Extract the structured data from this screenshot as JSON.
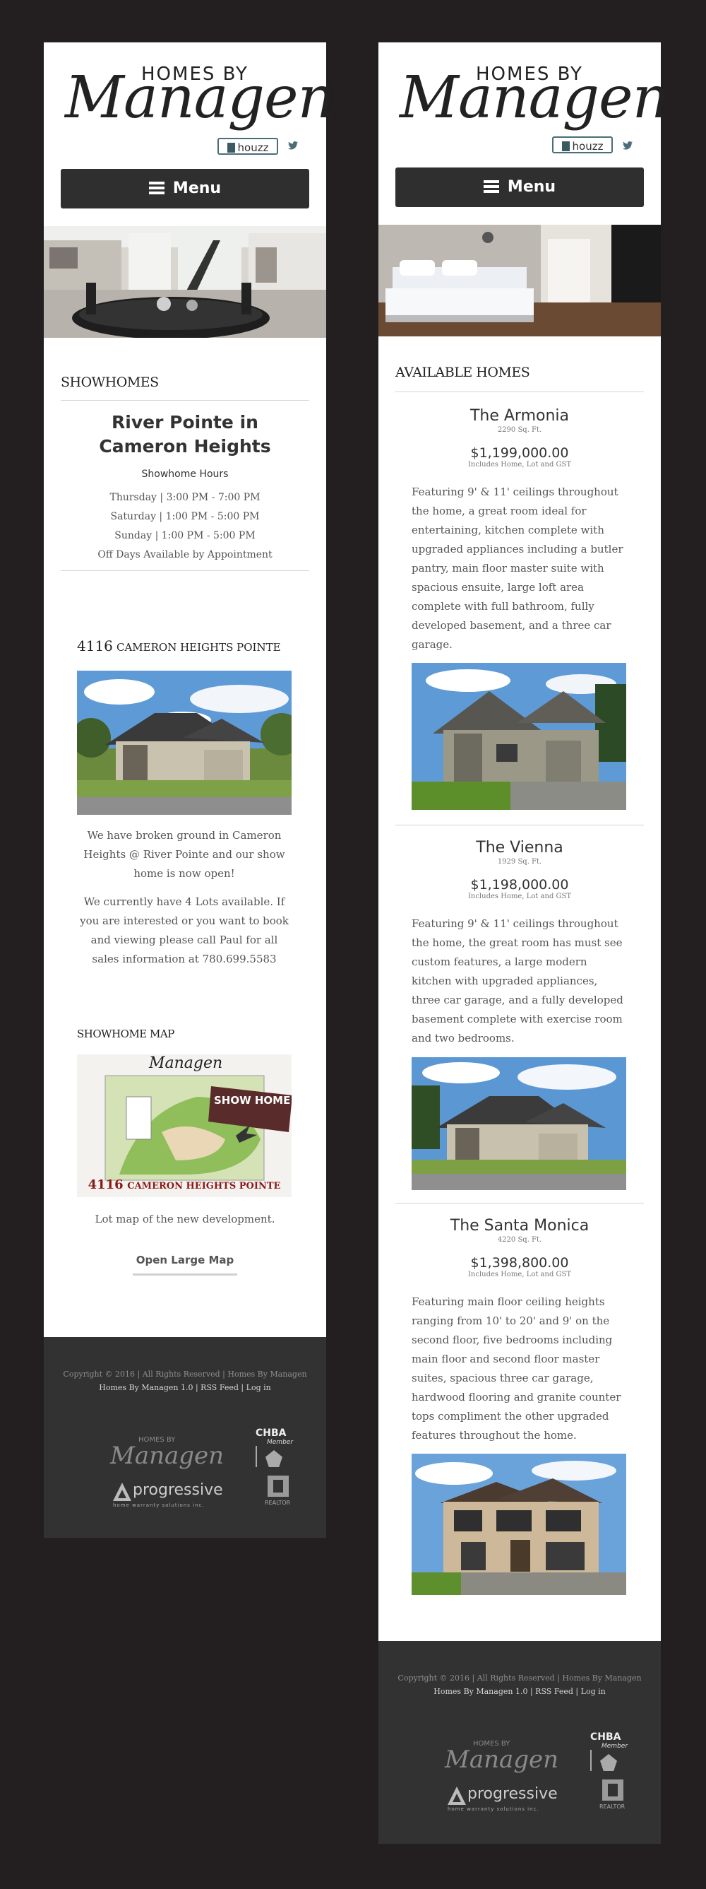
{
  "header": {
    "logo_top": "HOMES BY",
    "logo_script": "Managen",
    "houzz": "houzz",
    "twitter": "🐦",
    "menu": "Menu"
  },
  "left": {
    "showhomes_title": "SHOWHOMES",
    "location_title": "River Pointe in Cameron Heights",
    "hours_label": "Showhome Hours",
    "hours": [
      "Thursday | 3:00 PM - 7:00 PM",
      "Saturday | 1:00 PM - 5:00 PM",
      "Sunday | 1:00 PM - 5:00 PM",
      "Off Days Available by Appointment"
    ],
    "address_number": "4116",
    "address_street": "CAMERON HEIGHTS POINTE",
    "para1": "We have broken ground in Cameron Heights @ River Pointe and our show home is now open!",
    "para2": "We currently have 4 Lots available. If you are interested or you want to book and viewing please call Paul for all sales information at 780.699.5583",
    "map_title": "SHOWHOME MAP",
    "map_logo": "Managen",
    "map_banner": "SHOW HOME OPEN",
    "map_caption_number": "4116",
    "map_caption_street": "CAMERON HEIGHTS POINTE",
    "map_text": "Lot map of the new development.",
    "map_button": "Open Large Map"
  },
  "right": {
    "available_title": "AVAILABLE HOMES",
    "homes": [
      {
        "name": "The Armonia",
        "size": "2290 Sq. Ft.",
        "price": "$1,199,000.00",
        "price_note": "Includes Home, Lot and GST",
        "desc": "Featuring 9' & 11' ceilings throughout the home, a great room ideal for entertaining, kitchen complete with upgraded appliances including a butler pantry, main floor master suite with spacious ensuite, large loft area complete with full bathroom, fully developed basement, and a three car garage."
      },
      {
        "name": "The Vienna",
        "size": "1929 Sq. Ft.",
        "price": "$1,198,000.00",
        "price_note": "Includes Home, Lot and GST",
        "desc": "Featuring 9' & 11' ceilings throughout the home, the great room has must see custom features, a large modern kitchen with upgraded appliances, three car garage, and a fully developed basement complete with exercise room and two bedrooms."
      },
      {
        "name": "The Santa Monica",
        "size": "4220 Sq. Ft.",
        "price": "$1,398,800.00",
        "price_note": "Includes Home, Lot and GST",
        "desc": "Featuring main floor ceiling heights ranging from 10' to 20' and 9' on the second floor, five bedrooms including main floor and second floor master suites, spacious three car garage, hardwood flooring and granite counter tops compliment the other upgraded features throughout the home."
      }
    ]
  },
  "footer": {
    "copyright": "Copyright © 2016 | All Rights Reserved | Homes By Managen",
    "link1": "Homes By Managen 1.0",
    "link2": "RSS Feed",
    "link3": "Log in",
    "sep": "|",
    "logo_top": "HOMES BY",
    "logo_script": "Managen",
    "chba": "CHBA",
    "chba_member": "Member",
    "progressive": "progressive",
    "progressive_sub": "home warranty solutions inc.",
    "realtor": "REALTOR"
  },
  "colors": {
    "page_bg": "#231f20",
    "footer_bg": "#323232",
    "menu_bg": "#2f2f2f",
    "map_red": "#8b1a1a"
  }
}
